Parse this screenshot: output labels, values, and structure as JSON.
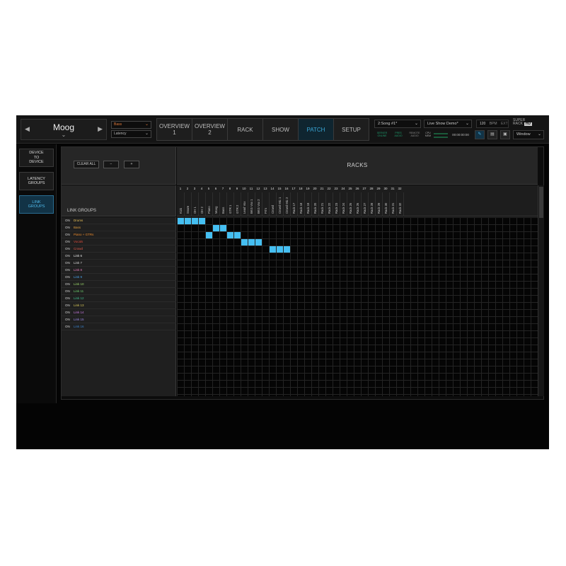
{
  "top": {
    "rack_name": "Moog",
    "prev_icon": "◀",
    "next_icon": "▶",
    "rack_chevron": "⌄",
    "drop1": "Bass",
    "drop2": "Latency",
    "tabs": [
      "OVERVIEW\n1",
      "OVERVIEW\n2",
      "RACK",
      "SHOW",
      "PATCH",
      "SETUP"
    ],
    "active_tab": 4,
    "song": "2:Song #1*",
    "show": "Live Show Demo*",
    "indicators": [
      "SERVER\nONLINE",
      "PRES\nAUDIO",
      "REMOTE\nAUDIO",
      "CPU\nMEM"
    ],
    "time": "00:00:00:00",
    "tempo": "120",
    "tempo_unit": "BPM",
    "tempo_extra": "EXT",
    "logo": "SUPER\nRACK",
    "logo_badge": "HD",
    "window_label": "Window",
    "accent": "#45bff2"
  },
  "sidebar": {
    "items": [
      {
        "label": "DEVICE\nTO\nDEVICE"
      },
      {
        "label": "LATENCY\nGROUPS"
      },
      {
        "label": "LINK\nGROUPS"
      }
    ],
    "active": 2
  },
  "main": {
    "clear_all": "CLEAR ALL",
    "minus": "−",
    "plus": "+",
    "racks_title": "RACKS",
    "link_groups_title": "LINK GROUPS"
  },
  "columns": [
    "Kick",
    "Snare",
    "OH 1",
    "OH 2",
    "Piano",
    "Moog",
    "Bass",
    "GTR 1",
    "GTR 2",
    "Lead Vox",
    "BKG Vox 1",
    "BKG Vox 2",
    "FX's",
    "Crowd",
    "Crowd Mic 1",
    "Crowd Mic 2",
    "Rack 17",
    "Rack 18",
    "Rack 19",
    "Rack 20",
    "Rack 21",
    "Rack 22",
    "Rack 23",
    "Rack 24",
    "Rack 25",
    "Rack 26",
    "Rack 27",
    "Rack 28",
    "Rack 29",
    "Rack 30",
    "Rack 31",
    "Rack 32"
  ],
  "on_label": "ON",
  "groups": [
    {
      "name": "Drums",
      "color": "#e8c15a",
      "cols": [
        1,
        2,
        3,
        4
      ]
    },
    {
      "name": "Bass",
      "color": "#e0a040",
      "cols": [
        6,
        7
      ]
    },
    {
      "name": "Piano + GTRs",
      "color": "#e9892c",
      "cols": [
        5,
        8,
        9
      ]
    },
    {
      "name": "Vocals",
      "color": "#d84a3a",
      "cols": [
        10,
        11,
        12
      ]
    },
    {
      "name": "Crowd",
      "color": "#e05a4a",
      "cols": [
        14,
        15,
        16
      ]
    },
    {
      "name": "Link 6",
      "color": "#e6e6e6",
      "cols": []
    },
    {
      "name": "Link 7",
      "color": "#d8d8d8",
      "cols": []
    },
    {
      "name": "Link 8",
      "color": "#e07ab8",
      "cols": []
    },
    {
      "name": "Link 9",
      "color": "#4aa0e8",
      "cols": []
    },
    {
      "name": "Link 10",
      "color": "#9ad46a",
      "cols": []
    },
    {
      "name": "Link 11",
      "color": "#6fd26f",
      "cols": []
    },
    {
      "name": "Link 12",
      "color": "#3fbf8f",
      "cols": []
    },
    {
      "name": "Link 13",
      "color": "#d8c85a",
      "cols": []
    },
    {
      "name": "Link 14",
      "color": "#c87ae0",
      "cols": []
    },
    {
      "name": "Link 15",
      "color": "#9a8ae6",
      "cols": []
    },
    {
      "name": "Link 16",
      "color": "#3a80c8",
      "cols": []
    }
  ]
}
